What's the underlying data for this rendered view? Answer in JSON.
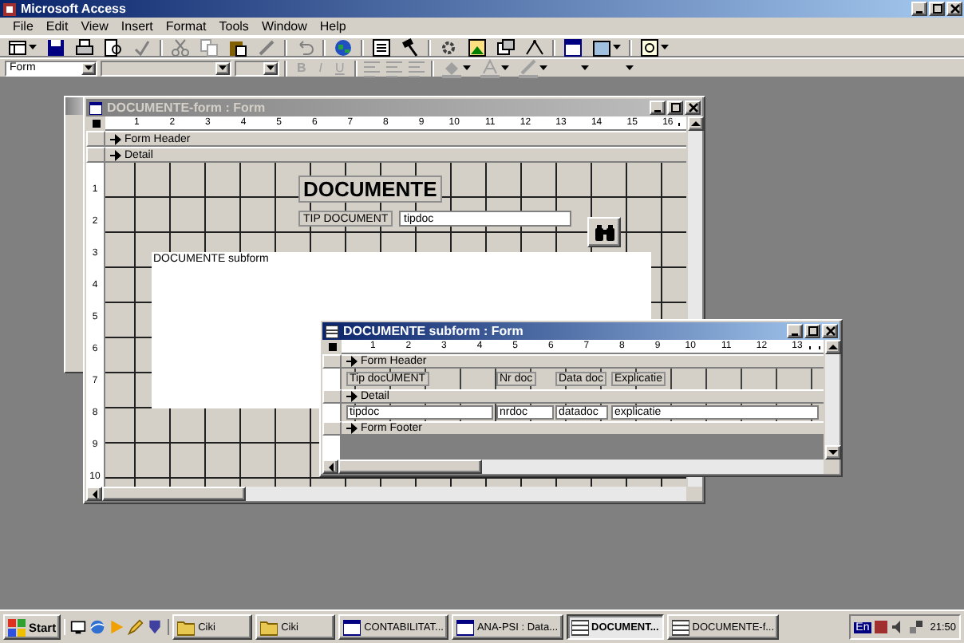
{
  "app_window": {
    "title": "Microsoft Access",
    "active": true
  },
  "menu_bar": [
    {
      "label": "File"
    },
    {
      "label": "Edit"
    },
    {
      "label": "View"
    },
    {
      "label": "Insert"
    },
    {
      "label": "Format"
    },
    {
      "label": "Tools"
    },
    {
      "label": "Window"
    },
    {
      "label": "Help"
    }
  ],
  "formatting_toolbar": {
    "object_combo": "Form",
    "text_buttons": [
      {
        "label": "B",
        "disabled": true
      },
      {
        "label": "I",
        "disabled": true
      },
      {
        "label": "U",
        "disabled": true
      }
    ]
  },
  "form_window": {
    "title": "DOCUMENTE-form : Form",
    "active": false,
    "ruler_numbers": [
      "1",
      "2",
      "3",
      "4",
      "5",
      "6",
      "7",
      "8",
      "9",
      "10",
      "11",
      "12",
      "13",
      "14",
      "15",
      "16"
    ],
    "vertical_ruler_numbers": [
      "1",
      "2",
      "3",
      "4",
      "5",
      "6",
      "7",
      "8",
      "9",
      "10"
    ],
    "sections": [
      "Form Header",
      "Detail"
    ],
    "title_label": "DOCUMENTE",
    "field_label": "TIP DOCUMENT",
    "field_textbox": "tipdoc",
    "subform_label": "DOCUMENTE subform"
  },
  "subform_window": {
    "title": "DOCUMENTE subform : Form",
    "active": true,
    "ruler_numbers": [
      "1",
      "2",
      "3",
      "4",
      "5",
      "6",
      "7",
      "8",
      "9",
      "10",
      "11",
      "12",
      "13"
    ],
    "header_section": "Form Header",
    "header_labels": [
      "Tip docUMENT",
      "Nr doc",
      "Data doc",
      "Explicatie"
    ],
    "detail_section": "Detail",
    "detail_textboxes": [
      "tipdoc",
      "nrdoc",
      "datadoc",
      "explicatie"
    ],
    "footer_section": "Form Footer"
  },
  "taskbar": {
    "start": "Start",
    "tasks": [
      {
        "label": "Ciki",
        "kind": "folder",
        "selected": false
      },
      {
        "label": "Ciki",
        "kind": "folder",
        "selected": false
      },
      {
        "label": "CONTABILITAT...",
        "kind": "database",
        "selected": false
      },
      {
        "label": "ANA-PSI : Data...",
        "kind": "database",
        "selected": false
      },
      {
        "label": "DOCUMENT...",
        "kind": "form",
        "selected": true
      },
      {
        "label": "DOCUMENTE-f...",
        "kind": "form",
        "selected": false
      }
    ],
    "language": "En",
    "clock": "21:50"
  }
}
